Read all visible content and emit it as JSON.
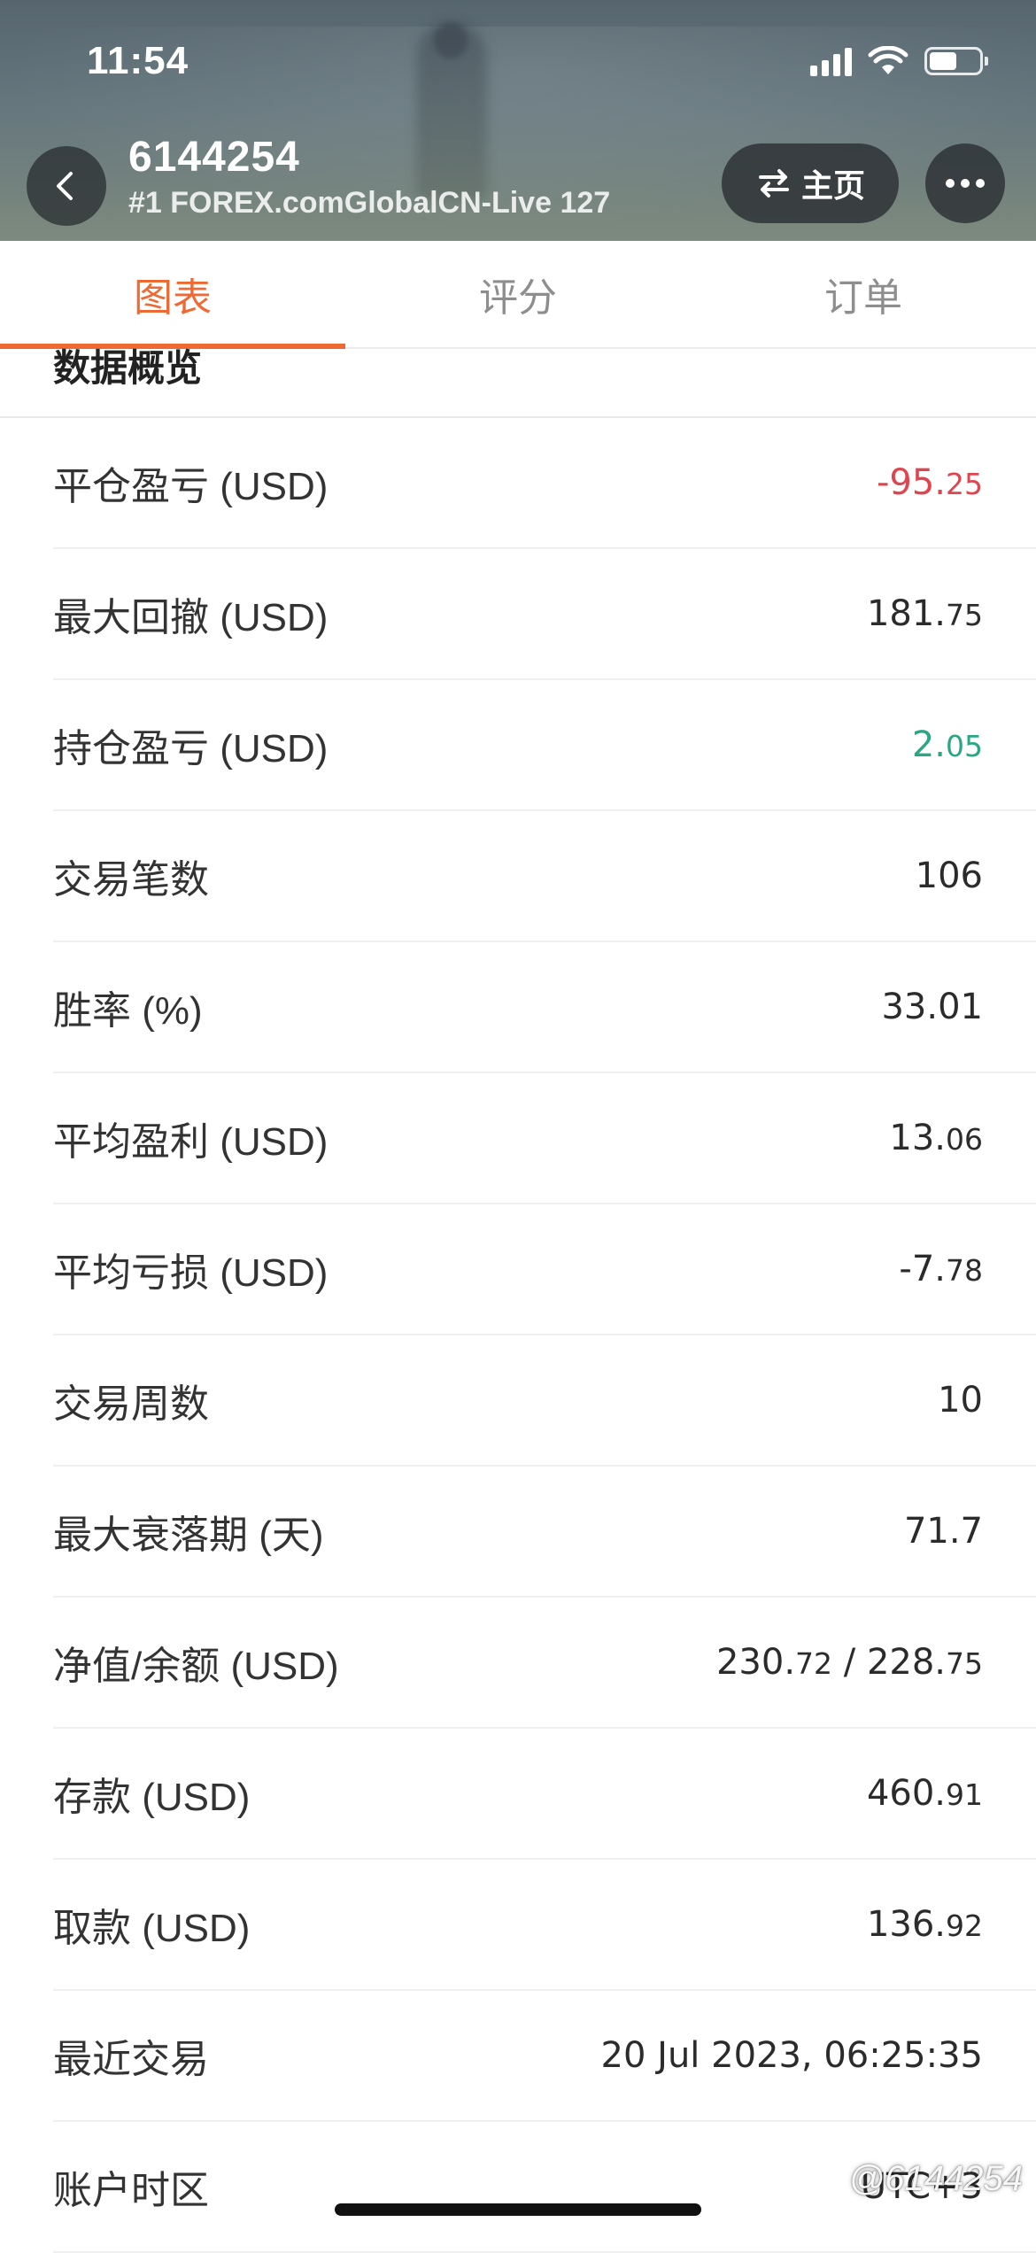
{
  "status_bar": {
    "time": "11:54"
  },
  "header": {
    "account_id": "6144254",
    "server": "#1 FOREX.comGlobalCN-Live 127",
    "home_label": "主页"
  },
  "tabs": [
    {
      "label": "图表",
      "active": true
    },
    {
      "label": "评分",
      "active": false
    },
    {
      "label": "订单",
      "active": false
    }
  ],
  "section": {
    "title": "数据概览"
  },
  "rows": [
    {
      "label": "平仓盈亏 (USD)",
      "int": "-95.",
      "dec": "25",
      "tone": "neg"
    },
    {
      "label": "最大回撤 (USD)",
      "int": "181.",
      "dec": "75",
      "tone": ""
    },
    {
      "label": "持仓盈亏 (USD)",
      "int": "2.",
      "dec": "05",
      "tone": "pos"
    },
    {
      "label": "交易笔数",
      "int": "106",
      "dec": "",
      "tone": ""
    },
    {
      "label": "胜率 (%)",
      "int": "33.01",
      "dec": "",
      "tone": ""
    },
    {
      "label": "平均盈利 (USD)",
      "int": "13.",
      "dec": "06",
      "tone": ""
    },
    {
      "label": "平均亏损 (USD)",
      "int": "-7.",
      "dec": "78",
      "tone": ""
    },
    {
      "label": "交易周数",
      "int": "10",
      "dec": "",
      "tone": ""
    },
    {
      "label": "最大衰落期 (天)",
      "int": "71.7",
      "dec": "",
      "tone": ""
    },
    {
      "label": "净值/余额 (USD)",
      "int": "230.",
      "dec": "72",
      "int2": " / 228.",
      "dec2": "75",
      "tone": ""
    },
    {
      "label": "存款 (USD)",
      "int": "460.",
      "dec": "91",
      "tone": ""
    },
    {
      "label": "取款 (USD)",
      "int": "136.",
      "dec": "92",
      "tone": ""
    },
    {
      "label": "最近交易",
      "int": "20 Jul 2023, 06:25:35",
      "dec": "",
      "tone": ""
    },
    {
      "label": "账户时区",
      "int": "UTC+3",
      "dec": "",
      "tone": ""
    }
  ],
  "watermark": "@6144254",
  "colors": {
    "accent": "#ef6a33",
    "negative": "#e0454f",
    "positive": "#27a883"
  },
  "battery_level": 0.55
}
